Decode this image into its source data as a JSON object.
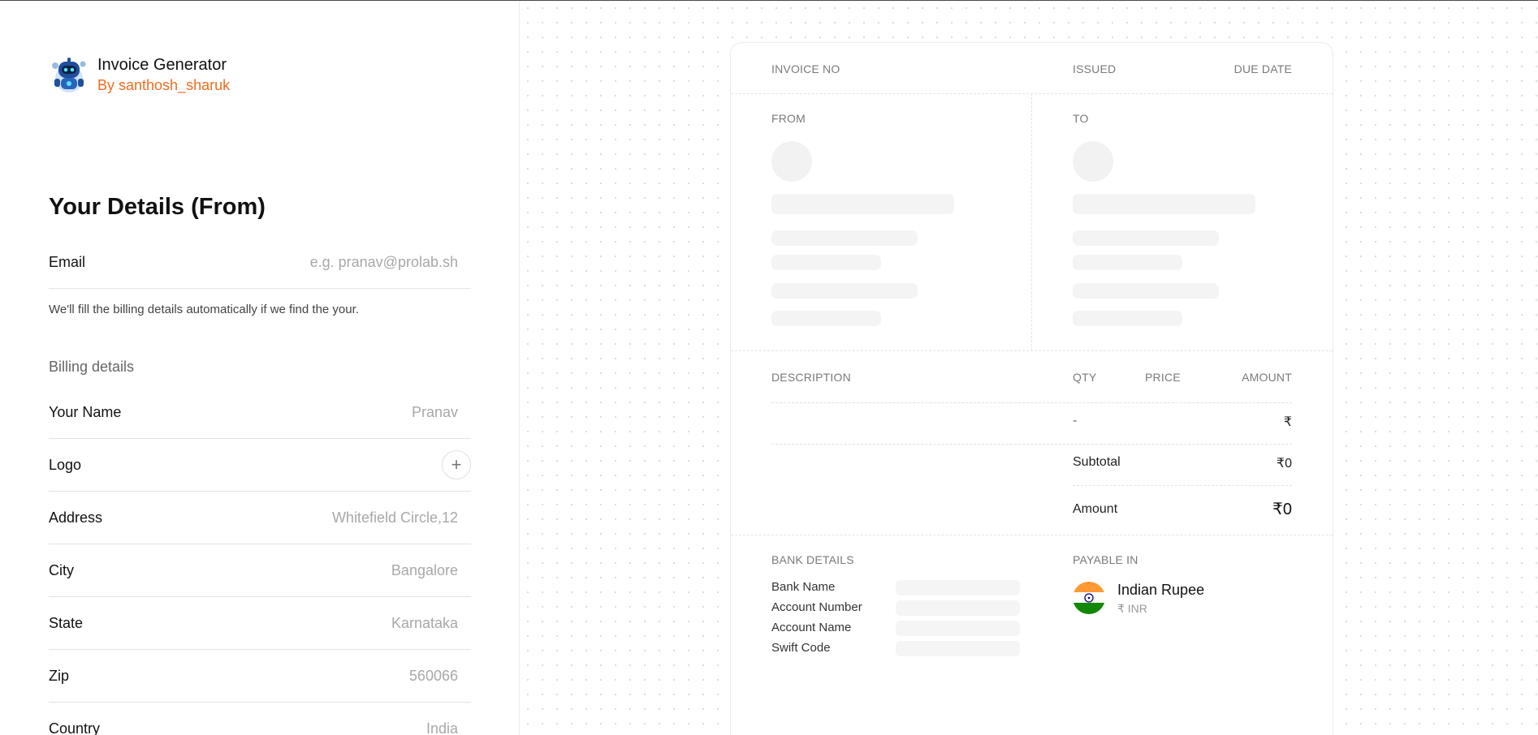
{
  "brand": {
    "title": "Invoice Generator",
    "subtitle": "By santhosh_sharuk",
    "accent": "#f26b1d"
  },
  "form": {
    "heading": "Your Details (From)",
    "email": {
      "label": "Email",
      "placeholder": "e.g. pranav@prolab.sh"
    },
    "hint": "We'll fill the billing details automatically if we find the your.",
    "billing_heading": "Billing details",
    "name": {
      "label": "Your Name",
      "placeholder": "Pranav"
    },
    "logo": {
      "label": "Logo",
      "button": "+"
    },
    "address": {
      "label": "Address",
      "placeholder": "Whitefield Circle,12"
    },
    "city": {
      "label": "City",
      "placeholder": "Bangalore"
    },
    "state": {
      "label": "State",
      "placeholder": "Karnataka"
    },
    "zip": {
      "label": "Zip",
      "placeholder": "560066"
    },
    "country": {
      "label": "Country",
      "placeholder": "India"
    }
  },
  "invoice": {
    "header": {
      "invoice_no": "INVOICE NO",
      "issued": "ISSUED",
      "due_date": "DUE DATE"
    },
    "from_label": "FROM",
    "to_label": "TO",
    "items_header": {
      "description": "DESCRIPTION",
      "qty": "QTY",
      "price": "PRICE",
      "amount": "AMOUNT"
    },
    "item_row": {
      "qty": "-",
      "amount": "₹"
    },
    "subtotal": {
      "label": "Subtotal",
      "value": "₹0"
    },
    "total": {
      "label": "Amount",
      "value": "₹0"
    },
    "bank": {
      "heading": "BANK DETAILS",
      "fields": [
        "Bank Name",
        "Account Number",
        "Account Name",
        "Swift Code"
      ]
    },
    "payable": {
      "heading": "PAYABLE IN",
      "currency": "Indian Rupee",
      "code": "₹ INR"
    }
  }
}
